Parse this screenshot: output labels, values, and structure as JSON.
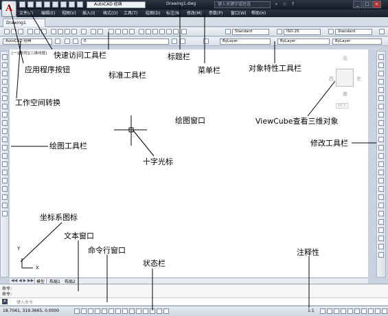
{
  "titlebar": {
    "app_button": "A",
    "workspace": "AutoCAD 经典",
    "title": "Drawing1.dwg",
    "search_placeholder": "键入关键字或短语"
  },
  "menus": [
    "文件(F)",
    "编辑(E)",
    "视图(V)",
    "插入(I)",
    "格式(O)",
    "工具(T)",
    "绘图(D)",
    "标注(N)",
    "修改(M)",
    "参数(P)",
    "窗口(W)",
    "帮助(H)"
  ],
  "doc_tab": "Drawing1",
  "toolbar2": {
    "text_style": "Standard",
    "dim_style": "ISO-25",
    "table_style": "Standard"
  },
  "toolbar3": {
    "workspace": "AutoCAD 经典",
    "layer": "0",
    "color": "ByLayer",
    "linetype": "ByLayer",
    "lineweight": "ByLayer"
  },
  "drawing": {
    "viewport_label": "[一][俯视][二维线框]",
    "viewcube": {
      "north": "北",
      "south": "南",
      "east": "东",
      "west": "西",
      "wcs": "WCS"
    },
    "ucs_x": "X",
    "ucs_y": "Y"
  },
  "layout_tabs": [
    "模型",
    "布局1",
    "布局2"
  ],
  "command": {
    "line1": "命令:",
    "line2": "命令:",
    "prompt": "键入命令"
  },
  "status": {
    "coords": "18.7041,  319.3665, 0.0000",
    "annotation_scale": "1:1"
  },
  "annotations": {
    "app_button": "应用程序按钮",
    "quick_access": "快速访问工具栏",
    "standard_toolbar": "标准工具栏",
    "title_bar": "标题栏",
    "menu_bar": "菜单栏",
    "properties_toolbar": "对象特性工具栏",
    "workspace_switch": "工作空间转换",
    "drawing_window": "绘图窗口",
    "viewcube": "ViewCube查看三维对象",
    "draw_toolbar": "绘图工具栏",
    "modify_toolbar": "修改工具栏",
    "crosshair": "十字光标",
    "ucs_icon": "坐标系图标",
    "text_window": "文本窗口",
    "command_window": "命令行窗口",
    "status_bar": "状态栏",
    "annotation": "注释性"
  }
}
